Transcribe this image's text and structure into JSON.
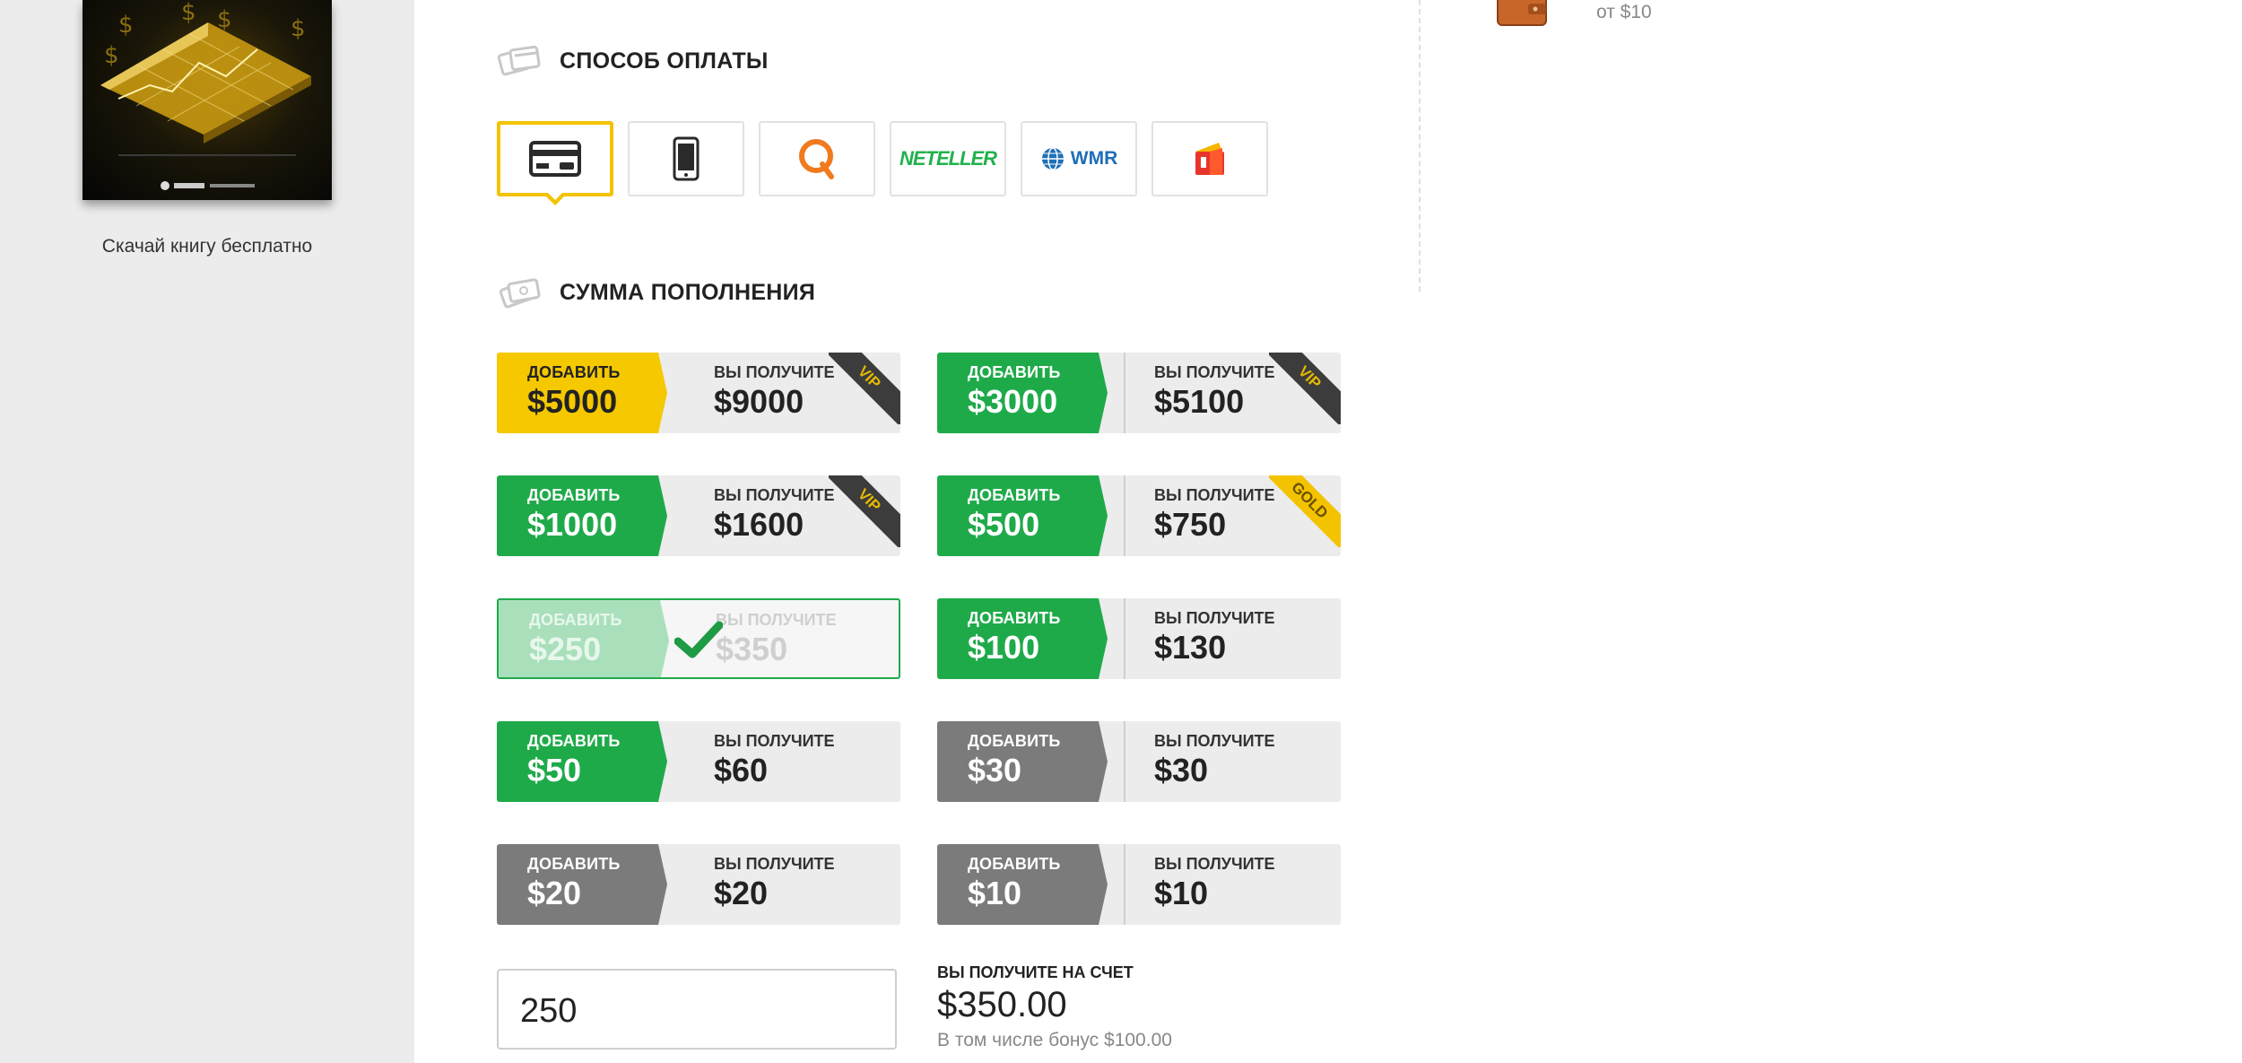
{
  "sidebar": {
    "book_caption": "Скачай книгу бесплатно"
  },
  "payment": {
    "title": "СПОСОБ ОПЛАТЫ",
    "methods": [
      {
        "name": "bank-card",
        "icon": "credit-card-icon",
        "active": true
      },
      {
        "name": "mobile",
        "icon": "mobile-phone-icon",
        "active": false
      },
      {
        "name": "qiwi",
        "icon": "qiwi-icon",
        "active": false
      },
      {
        "name": "neteller",
        "label": "NETELLER",
        "active": false
      },
      {
        "name": "webmoney",
        "label": "WMR",
        "active": false
      },
      {
        "name": "yandex-money",
        "icon": "yandex-wallet-icon",
        "active": false
      }
    ]
  },
  "deposit": {
    "title": "СУММА ПОПОЛНЕНИЯ",
    "add_label": "ДОБАВИТЬ",
    "get_label": "ВЫ ПОЛУЧИТЕ",
    "packages": [
      {
        "add": "$5000",
        "get": "$9000",
        "style": "yellow",
        "ribbon": "VIP"
      },
      {
        "add": "$3000",
        "get": "$5100",
        "style": "green",
        "ribbon": "VIP"
      },
      {
        "add": "$1000",
        "get": "$1600",
        "style": "green",
        "ribbon": "VIP"
      },
      {
        "add": "$500",
        "get": "$750",
        "style": "green",
        "ribbon": "GOLD"
      },
      {
        "add": "$250",
        "get": "$350",
        "style": "selected",
        "ribbon": ""
      },
      {
        "add": "$100",
        "get": "$130",
        "style": "green",
        "ribbon": ""
      },
      {
        "add": "$50",
        "get": "$60",
        "style": "green",
        "ribbon": ""
      },
      {
        "add": "$30",
        "get": "$30",
        "style": "grey",
        "ribbon": ""
      },
      {
        "add": "$20",
        "get": "$20",
        "style": "grey",
        "ribbon": ""
      },
      {
        "add": "$10",
        "get": "$10",
        "style": "grey",
        "ribbon": ""
      }
    ],
    "amount_value": "250",
    "receive_label": "ВЫ ПОЛУЧИТЕ НА СЧЕТ",
    "receive_amount": "$350.00",
    "receive_bonus": "В том числе бонус $100.00"
  },
  "right_panel": {
    "min_text": "от $10"
  },
  "colors": {
    "accent_yellow": "#f3c300",
    "accent_green": "#1faa4a",
    "neutral_grey": "#7b7b7b"
  }
}
